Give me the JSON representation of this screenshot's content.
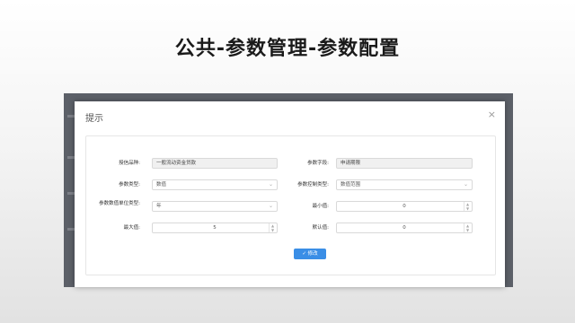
{
  "slide": {
    "title": "公共-参数管理-参数配置"
  },
  "dialog": {
    "title": "提示",
    "close_glyph": "×"
  },
  "form": {
    "credit_product": {
      "label": "授信品种:",
      "value": "一般流动资金贷款"
    },
    "param_field": {
      "label": "参数字段:",
      "value": "申请期限"
    },
    "param_type": {
      "label": "参数类型:",
      "value": "数值"
    },
    "param_control_type": {
      "label": "参数控制类型:",
      "value": "数值范围"
    },
    "param_unit": {
      "label": "参数数值单位类型:",
      "value": "年"
    },
    "min_value": {
      "label": "最小值:",
      "value": "0"
    },
    "max_value": {
      "label": "最大值:",
      "value": "5"
    },
    "default_value": {
      "label": "默认值:",
      "value": "0"
    },
    "submit_button": {
      "icon": "✓",
      "label": "修改"
    }
  }
}
